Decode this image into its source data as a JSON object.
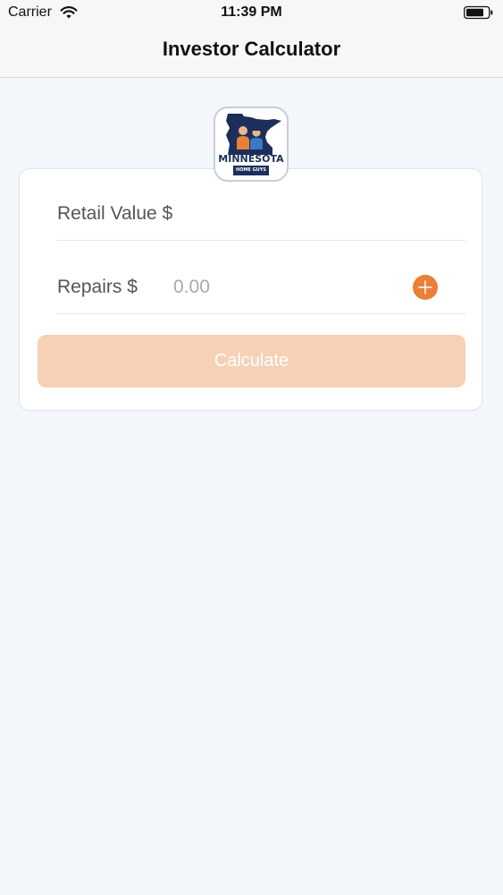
{
  "status_bar": {
    "carrier": "Carrier",
    "time": "11:39 PM",
    "wifi_icon": "wifi-icon",
    "battery_icon": "battery-icon"
  },
  "nav": {
    "title": "Investor Calculator"
  },
  "logo": {
    "word": "MINNESOTA",
    "sub": "HOME GUYS",
    "colors": {
      "navy": "#1c2f5a",
      "orange": "#ea7f36"
    }
  },
  "form": {
    "retail_label": "Retail Value $",
    "retail_value": "",
    "repairs_label": "Repairs $",
    "repairs_placeholder": "0.00",
    "repairs_value": "",
    "add_icon": "plus-circle-icon",
    "calculate_label": "Calculate"
  },
  "colors": {
    "accent": "#ea7f36",
    "button_disabled": "#f6d1b6",
    "background": "#f3f7fb"
  }
}
